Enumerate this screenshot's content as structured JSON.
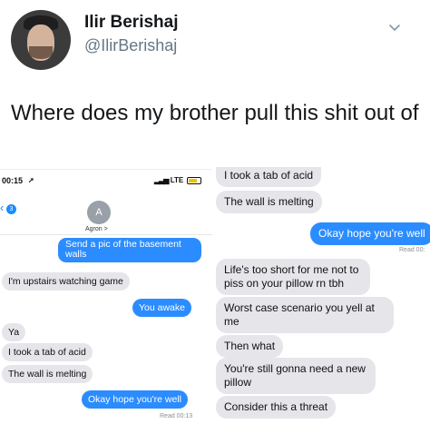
{
  "tweet": {
    "display_name": "Ilir Berishaj",
    "handle": "@IlirBerishaj",
    "text": "Where does my brother pull this shit out of"
  },
  "left_screenshot": {
    "status_time": "00:15",
    "status_network": "LTE",
    "back_count": "3",
    "contact_initial": "A",
    "contact_name": "Agron >",
    "messages": [
      {
        "side": "out",
        "text": "Send a pic of the basement"
      },
      {
        "side": "out",
        "text": "walls"
      },
      {
        "side": "in",
        "text": "I'm upstairs watching game"
      },
      {
        "side": "out",
        "text": "You awake"
      },
      {
        "side": "in",
        "text": "Ya"
      },
      {
        "side": "in",
        "text": "I took a tab of acid"
      },
      {
        "side": "in",
        "text": "The wall is melting"
      },
      {
        "side": "out",
        "text": "Okay hope you're well"
      }
    ],
    "read_receipt": "Read 00:13"
  },
  "right_screenshot": {
    "messages": [
      {
        "side": "in",
        "text": "I took a tab of acid"
      },
      {
        "side": "in",
        "text": "The wall is melting"
      },
      {
        "side": "out",
        "text": "Okay hope you're well"
      },
      {
        "side": "in",
        "text": "Life's too short for me not to piss on your pillow rn tbh"
      },
      {
        "side": "in",
        "text": "Worst case scenario you yell at me"
      },
      {
        "side": "in",
        "text": "Then what"
      },
      {
        "side": "in",
        "text": "You're still gonna need a new pillow"
      },
      {
        "side": "in",
        "text": "Consider this a threat"
      }
    ],
    "read_receipt": "Read 00:"
  },
  "icons": {
    "caret": "chevron-down-icon",
    "back": "chevron-left-icon",
    "battery": "battery-icon"
  },
  "colors": {
    "imessage_blue": "#2b8cff",
    "bubble_gray": "#e5e5ea",
    "handle_gray": "#657786"
  }
}
